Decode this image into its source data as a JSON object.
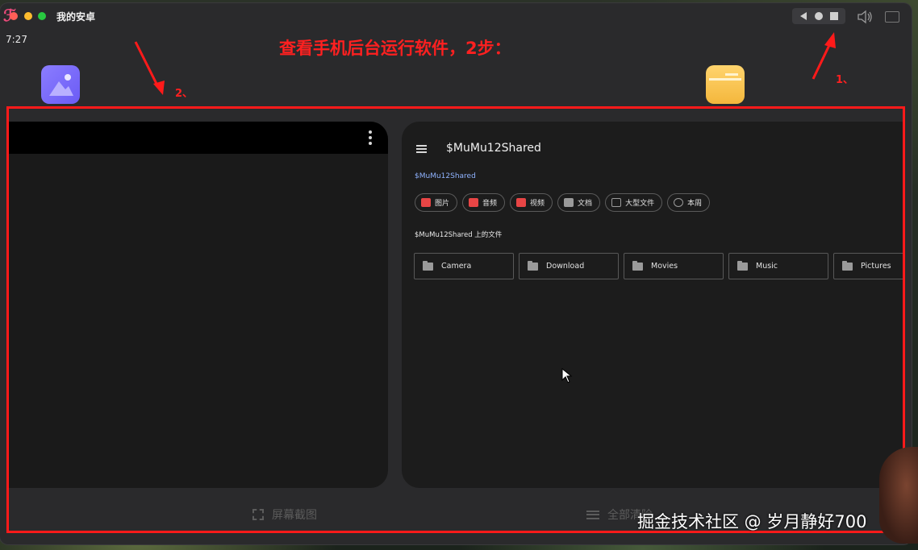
{
  "window": {
    "title": "我的安卓"
  },
  "status_bar": {
    "time": "7:27"
  },
  "annotation": {
    "title": "查看手机后台运行软件，2步：",
    "step1": "1、",
    "step2": "2、"
  },
  "nav_icons": [
    "back-icon",
    "home-icon",
    "recents-icon",
    "volume-icon",
    "keyboard-icon"
  ],
  "files_app": {
    "title": "$MuMu12Shared",
    "breadcrumb": "$MuMu12Shared",
    "chips": [
      {
        "label": "图片",
        "color": "#e84545"
      },
      {
        "label": "音频",
        "color": "#e84545"
      },
      {
        "label": "视频",
        "color": "#e84545"
      },
      {
        "label": "文档",
        "color": "#9a9a9a"
      },
      {
        "label": "大型文件",
        "color": "#9a9a9a"
      },
      {
        "label": "本周",
        "color": "#9a9a9a"
      }
    ],
    "section_label": "$MuMu12Shared 上的文件",
    "folders": [
      "Camera",
      "Download",
      "Movies",
      "Music",
      "Pictures"
    ]
  },
  "bottom_actions": {
    "screenshot": "屏幕截图",
    "clear_all": "全部清除"
  },
  "watermark": "掘金技术社区 @ 岁月静好700",
  "colors": {
    "annotation_red": "#ff1a1a",
    "link_blue": "#8fb3ff"
  }
}
